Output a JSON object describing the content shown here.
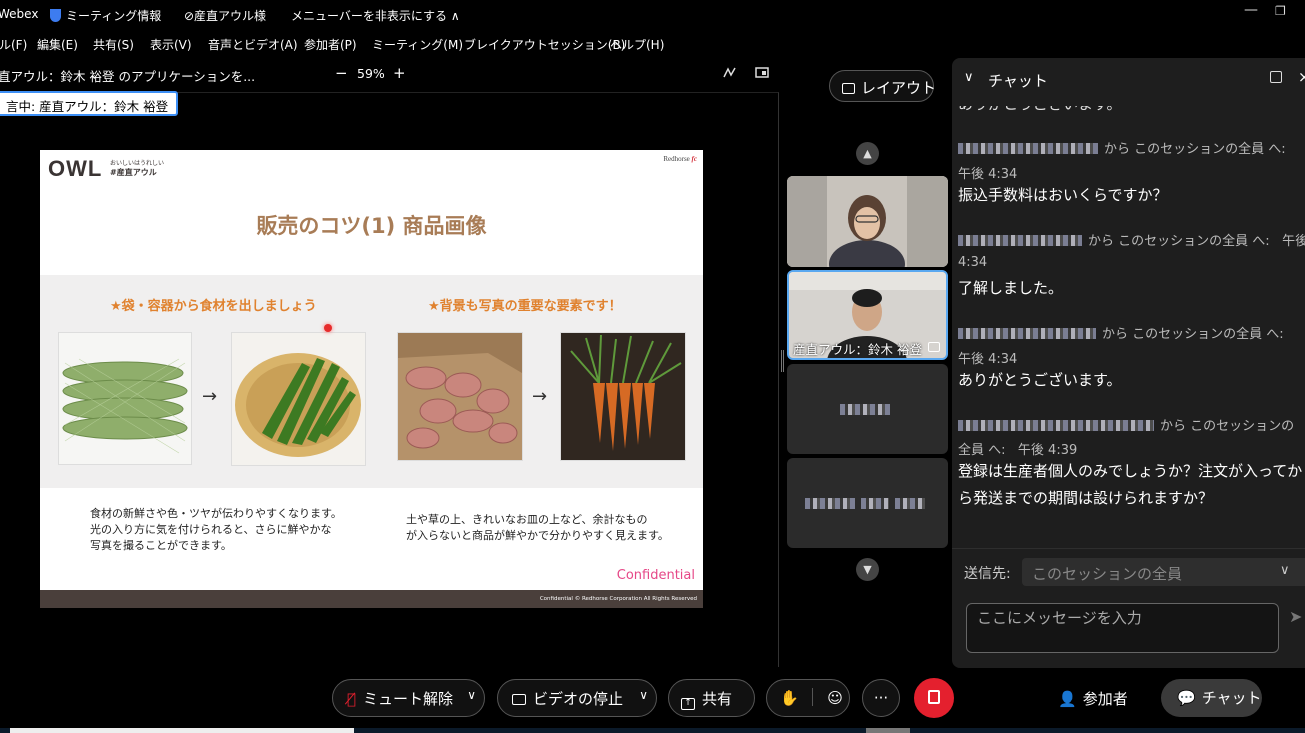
{
  "titlebar": {
    "app": "Webex",
    "meeting_info": "ミーティング情報",
    "host": "⊘産直アウル様",
    "hide_menu": "メニューバーを非表示にする ∧",
    "minimize": "—",
    "restore": "❐"
  },
  "menubar": [
    "ル(F)",
    "編集(E)",
    "共有(S)",
    "表示(V)",
    "音声とビデオ(A)",
    "参加者(P)",
    "ミーティング(M)",
    "ブレイクアウトセッション(B)",
    "ヘルプ(H)"
  ],
  "share": {
    "label": "直アウル：鈴木 裕登 のアプリケーションを...",
    "zoom_out": "−",
    "zoom": "59%",
    "zoom_in": "+",
    "speaker_tag": "言中: 産直アウル：鈴木 裕登"
  },
  "slide": {
    "logo": "OWL",
    "logo_sub1": "おいしいはうれしい",
    "logo_sub2": "#産直アウル",
    "brand": "Redhorse",
    "brand_mark": "fc",
    "title": "販売のコツ(1)  商品画像",
    "left_heading": "★袋・容器から食材を出しましょう",
    "right_heading": "★背景も写真の重要な要素です！",
    "arrow": "→",
    "left_desc_1": "食材の新鮮さや色・ツヤが伝わりやすくなります。",
    "left_desc_2": "光の入り方に気を付けられると、さらに鮮やかな",
    "left_desc_3": "写真を撮ることができます。",
    "right_desc_1": "土や草の上、きれいなお皿の上など、余計なもの",
    "right_desc_2": "が入らないと商品が鮮やかで分かりやすく見えます。",
    "confidential": "Confidential",
    "footer": "Confidential © Redhorse Corporation All Rights Reserved"
  },
  "participants": {
    "layout": "レイアウト",
    "up": "▲",
    "down": "▼",
    "tile2_name": "産直アウル：鈴木 裕登"
  },
  "chat": {
    "title": "チャット",
    "messages": [
      {
        "meta_to": "から このセッションの全員 へ:",
        "time": "午後 4:34",
        "text": "振込手数料はおいくらですか？"
      },
      {
        "meta_to": "から このセッションの全員 へ:",
        "time": "午後",
        "time2": "4:34",
        "text": "了解しました。"
      },
      {
        "meta_to": "から このセッションの全員 へ:",
        "time": "午後 4:34",
        "text": "ありがとうございます。"
      },
      {
        "meta_to": "から このセッションの",
        "meta_to2": "全員 へ:",
        "time": "午後 4:39",
        "text1": "登録は生産者個人のみでしょうか？注文が入ってか",
        "text2": "ら発送までの期間は設けられますか？"
      }
    ],
    "to_label": "送信先:",
    "to_value": "このセッションの全員",
    "input_placeholder": "ここにメッセージを入力"
  },
  "toolbar": {
    "unmute": "ミュート解除",
    "stop_video": "ビデオの停止",
    "share": "共有",
    "more": "···",
    "participants": "参加者",
    "chat": "チャット"
  },
  "colors": {
    "accent": "#3d8ff5",
    "leave": "#e4202e",
    "slide_title": "#a87c56",
    "slide_heading": "#e0822f"
  }
}
